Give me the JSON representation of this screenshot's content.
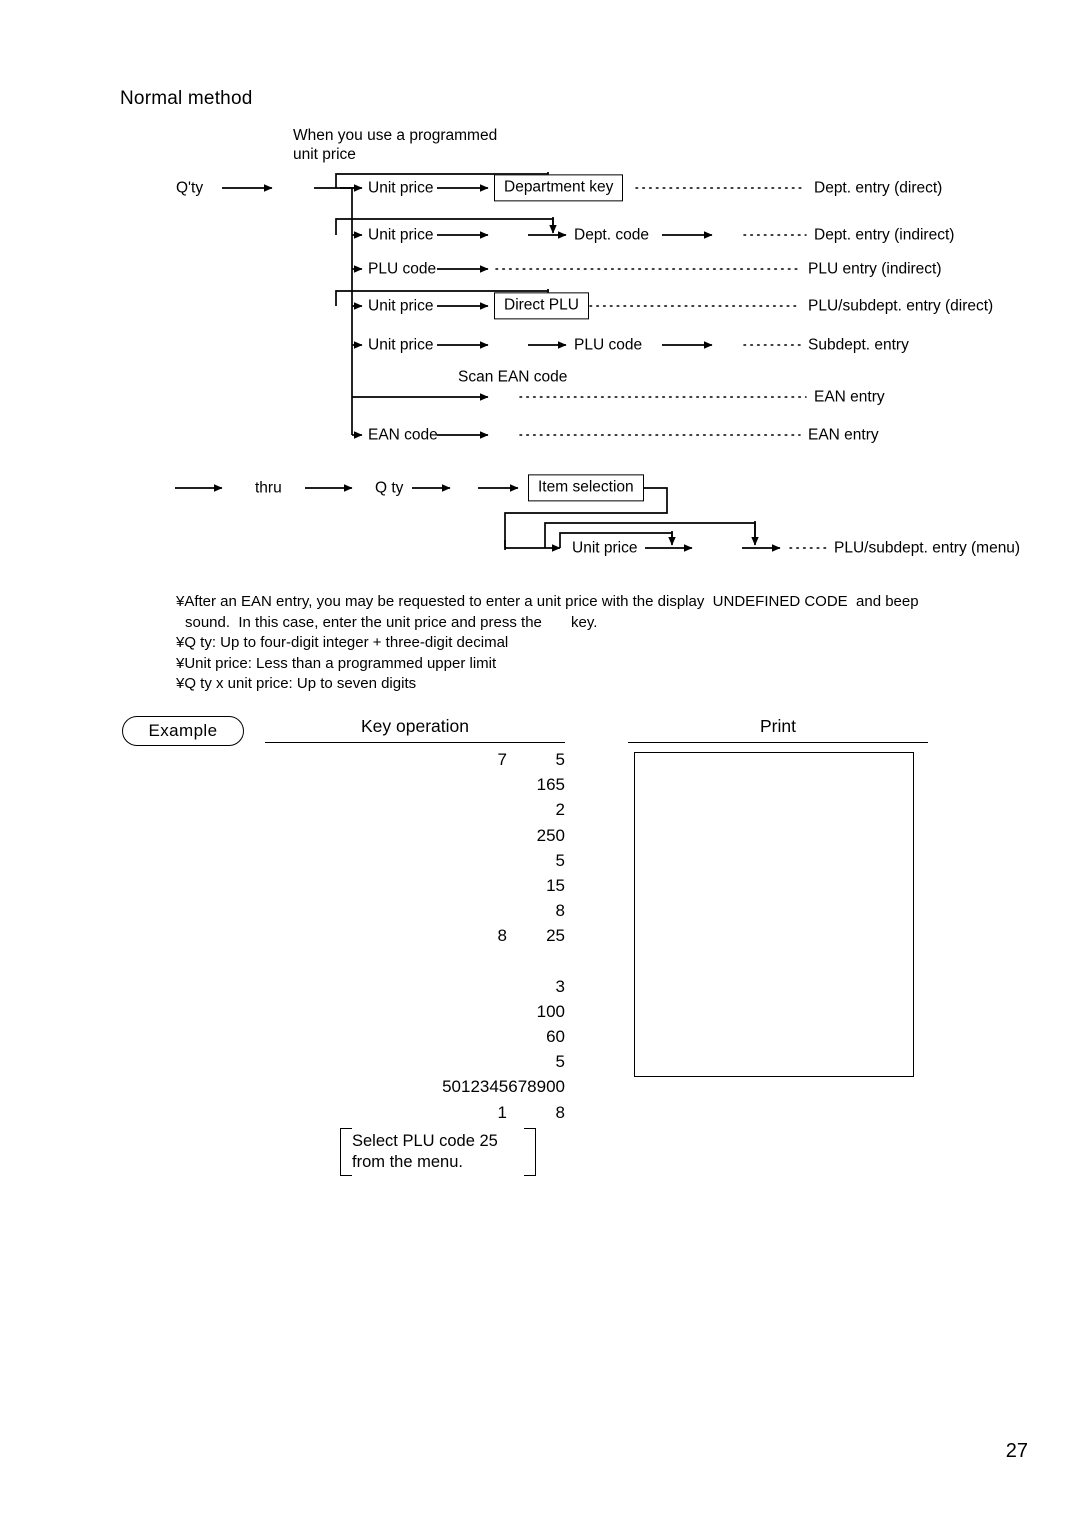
{
  "page": {
    "heading": "Normal method",
    "number": "27"
  },
  "diagram": {
    "programmed_price_note": "When you use a programmed\nunit price",
    "qty_label": "Q'ty",
    "scan_ean_label": "Scan EAN code",
    "rows": [
      {
        "step": "Unit price",
        "box": "Department key",
        "result": "Dept. entry (direct)"
      },
      {
        "step": "Unit price",
        "mid": "Dept. code",
        "result": "Dept. entry (indirect)"
      },
      {
        "step": "PLU code",
        "result": "PLU entry (indirect)"
      },
      {
        "step": "Unit price",
        "box": "Direct PLU",
        "result": "PLU/subdept. entry (direct)"
      },
      {
        "step": "Unit price",
        "mid": "PLU code",
        "result": "Subdept. entry"
      },
      {
        "step": "",
        "result": "EAN entry"
      },
      {
        "step": "EAN code",
        "result": "EAN entry"
      }
    ],
    "menu_row": {
      "thru_label": "thru",
      "qty_label": "Q ty",
      "box": "Item selection",
      "step": "Unit price",
      "result": "PLU/subdept. entry (menu)"
    }
  },
  "notes": [
    "¥After an EAN entry, you may be requested to enter a unit price with the display  UNDEFINED CODE  and beep",
    "sound.  In this case, enter the unit price and press the       key.",
    "¥Q ty: Up to four-digit integer + three-digit decimal",
    "¥Unit price: Less than a programmed upper limit",
    "¥Q ty x unit price: Up to seven digits"
  ],
  "example": {
    "pill_label": "Example",
    "key_operation_header": "Key operation",
    "print_header": "Print",
    "key_operation_rows": [
      {
        "left": "7",
        "right": "5"
      },
      {
        "right": "165"
      },
      {
        "right": "2"
      },
      {
        "right": "250"
      },
      {
        "right": "5"
      },
      {
        "right": "15"
      },
      {
        "right": "8"
      },
      {
        "left": "8",
        "right": "25"
      },
      {
        "gap": true
      },
      {
        "right": "3"
      },
      {
        "right": "100"
      },
      {
        "right": "60"
      },
      {
        "right": "5"
      },
      {
        "wide": "5012345678900"
      },
      {
        "left": "1",
        "right": "8"
      }
    ],
    "menu_note": "Select PLU code 25\nfrom the menu."
  }
}
